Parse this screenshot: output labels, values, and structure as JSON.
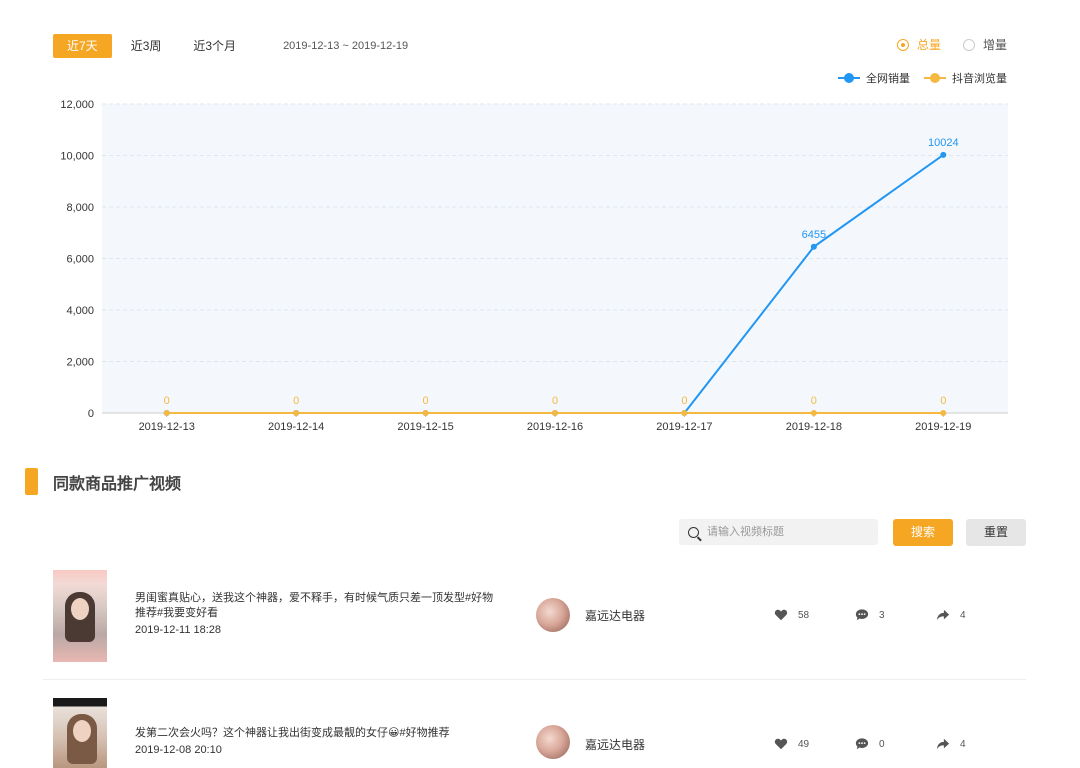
{
  "tabs": [
    "近7天",
    "近3周",
    "近3个月"
  ],
  "date_range": "2019-12-13 ~ 2019-12-19",
  "radios": {
    "total": "总量",
    "increment": "增量"
  },
  "legend": {
    "series1": "全网销量",
    "series2": "抖音浏览量"
  },
  "colors": {
    "accent": "#f5a623",
    "series1": "#2196f3",
    "series2": "#f5b942"
  },
  "chart_data": {
    "type": "line",
    "x": [
      "2019-12-13",
      "2019-12-14",
      "2019-12-15",
      "2019-12-16",
      "2019-12-17",
      "2019-12-18",
      "2019-12-19"
    ],
    "y_ticks": [
      "0",
      "2,000",
      "4,000",
      "6,000",
      "8,000",
      "10,000",
      "12,000"
    ],
    "ylim": [
      0,
      12000
    ],
    "grid": true,
    "legend_position": "top-right",
    "series": [
      {
        "name": "全网销量",
        "values": [
          0,
          0,
          0,
          0,
          0,
          6455,
          10024
        ],
        "labels": [
          "",
          "",
          "",
          "",
          "",
          "6455",
          "10024"
        ]
      },
      {
        "name": "抖音浏览量",
        "values": [
          0,
          0,
          0,
          0,
          0,
          0,
          0
        ],
        "labels": [
          "0",
          "0",
          "0",
          "0",
          "0",
          "0",
          "0"
        ]
      }
    ]
  },
  "section_title": "同款商品推广视频",
  "search": {
    "placeholder": "请输入视频标题",
    "button": "搜索",
    "reset": "重置"
  },
  "videos": [
    {
      "title": "男闺蜜真贴心，送我这个神器，爱不释手，有时候气质只差一顶发型#好物推荐#我要变好看",
      "date": "2019-12-11 18:28",
      "author": "嘉远达电器",
      "likes": "58",
      "comments": "3",
      "shares": "4"
    },
    {
      "title": "发第二次会火吗？这个神器让我出街变成最靓的女仔😀#好物推荐",
      "date": "2019-12-08 20:10",
      "author": "嘉远达电器",
      "likes": "49",
      "comments": "0",
      "shares": "4"
    }
  ]
}
